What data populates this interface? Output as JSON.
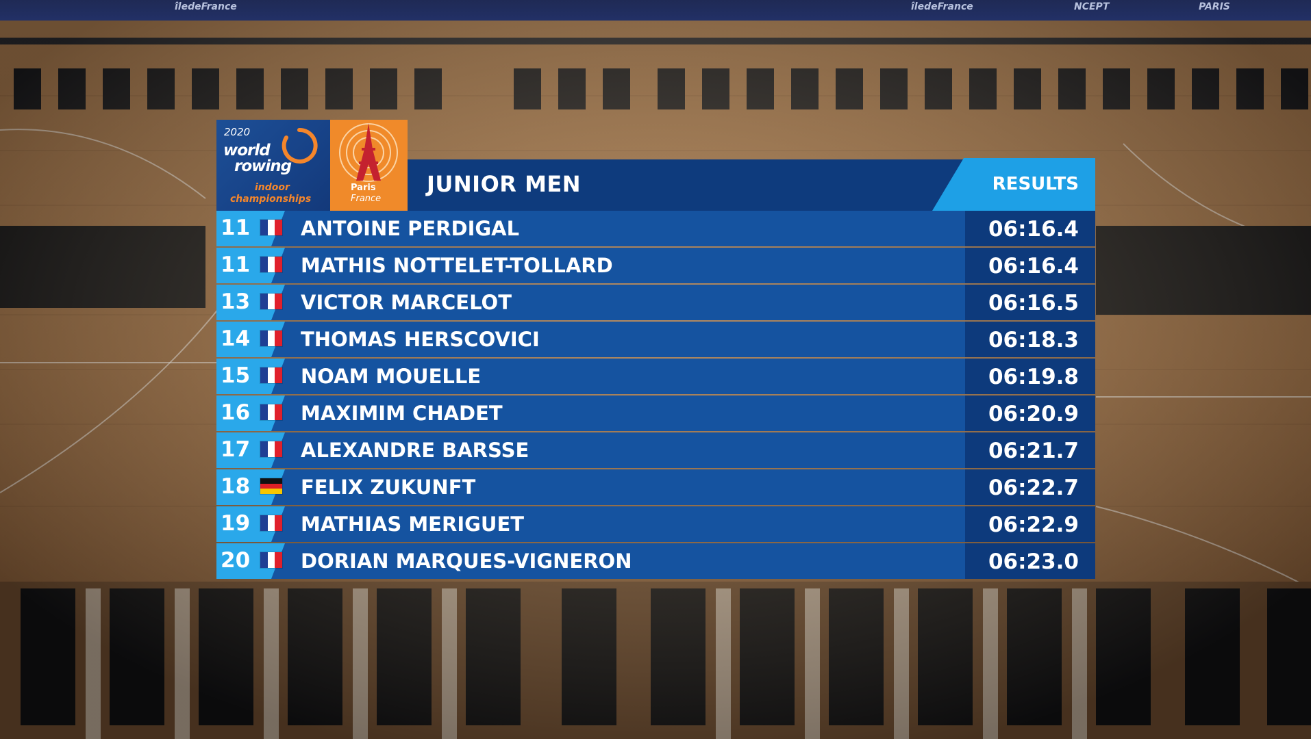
{
  "broadcast": {
    "sponsors": [
      "îledeFrance",
      "îledeFrance",
      "NCEPT",
      "PARIS"
    ]
  },
  "logo": {
    "year": "2020",
    "line1": "world",
    "line2": "rowing",
    "line3": "indoor",
    "line4": "championships",
    "host_city": "Paris",
    "host_country": "France"
  },
  "header": {
    "event_title": "JUNIOR MEN",
    "badge": "RESULTS"
  },
  "colors": {
    "accent_cyan": "#2aa8ea",
    "row_blue": "#1553a0",
    "time_blue": "#0d3a7c",
    "header_navy": "#0e3b7d",
    "logo_orange": "#f08a2a"
  },
  "results": [
    {
      "rank": "11",
      "flag": "france-flag-icon",
      "name": "ANTOINE PERDIGAL",
      "time": "06:16.4"
    },
    {
      "rank": "11",
      "flag": "france-flag-icon",
      "name": "MATHIS NOTTELET-TOLLARD",
      "time": "06:16.4"
    },
    {
      "rank": "13",
      "flag": "france-flag-icon",
      "name": "VICTOR MARCELOT",
      "time": "06:16.5"
    },
    {
      "rank": "14",
      "flag": "france-flag-icon",
      "name": "THOMAS HERSCOVICI",
      "time": "06:18.3"
    },
    {
      "rank": "15",
      "flag": "france-flag-icon",
      "name": "NOAM MOUELLE",
      "time": "06:19.8"
    },
    {
      "rank": "16",
      "flag": "france-flag-icon",
      "name": "MAXIMIM CHADET",
      "time": "06:20.9"
    },
    {
      "rank": "17",
      "flag": "france-flag-icon",
      "name": "ALEXANDRE BARSSE",
      "time": "06:21.7"
    },
    {
      "rank": "18",
      "flag": "germany-flag-icon",
      "name": "FELIX ZUKUNFT",
      "time": "06:22.7"
    },
    {
      "rank": "19",
      "flag": "france-flag-icon",
      "name": "MATHIAS MERIGUET",
      "time": "06:22.9"
    },
    {
      "rank": "20",
      "flag": "france-flag-icon",
      "name": "DORIAN MARQUES-VIGNERON",
      "time": "06:23.0"
    }
  ]
}
